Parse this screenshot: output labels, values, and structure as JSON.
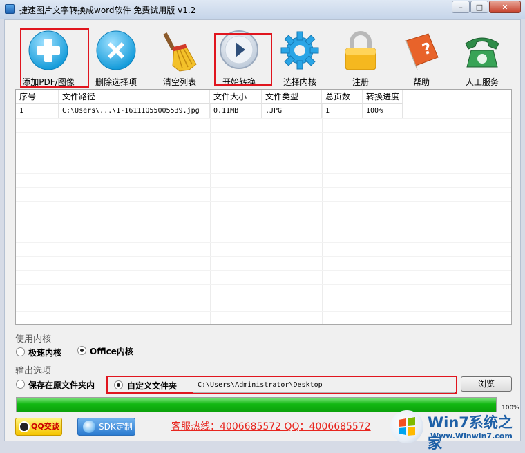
{
  "window": {
    "title": "捷速图片文字转换成word软件 免费试用版 v1.2",
    "minimize_glyph": "–",
    "maximize_glyph": "□",
    "close_glyph": "✕"
  },
  "toolbar": {
    "items": [
      {
        "label": "添加PDF/图像",
        "icon": "add-icon"
      },
      {
        "label": "删除选择项",
        "icon": "delete-icon"
      },
      {
        "label": "清空列表",
        "icon": "broom-icon"
      },
      {
        "label": "开始转换",
        "icon": "play-icon"
      },
      {
        "label": "选择内核",
        "icon": "gear-icon"
      },
      {
        "label": "注册",
        "icon": "lock-icon"
      },
      {
        "label": "帮助",
        "icon": "help-book-icon"
      },
      {
        "label": "人工服务",
        "icon": "phone-icon"
      }
    ]
  },
  "table": {
    "headers": [
      "序号",
      "文件路径",
      "文件大小",
      "文件类型",
      "总页数",
      "转换进度"
    ],
    "rows": [
      [
        "1",
        "C:\\Users\\...\\1-16111Q55005539.jpg",
        "0.11MB",
        ".JPG",
        "1",
        "100%"
      ]
    ]
  },
  "engine": {
    "section_label": "使用内核",
    "options": [
      "极速内核",
      "Office内核"
    ],
    "selected": "Office内核"
  },
  "output": {
    "section_label": "输出选项",
    "options": [
      "保存在原文件夹内",
      "自定义文件夹"
    ],
    "selected": "自定义文件夹",
    "path": "C:\\Users\\Administrator\\Desktop",
    "browse_label": "浏览"
  },
  "progress": {
    "value": 100,
    "text": "100%"
  },
  "footer": {
    "qq_label": "QQ交谈",
    "sdk_label": "SDK定制",
    "hotline": "客服热线：4006685572 QQ：4006685572",
    "watermark_text": "Win7系统之家",
    "watermark_url": "Www.Winwin7.com"
  },
  "colors": {
    "highlight": "#e0151e",
    "progress": "#13b813",
    "hotline": "#e8261e"
  }
}
